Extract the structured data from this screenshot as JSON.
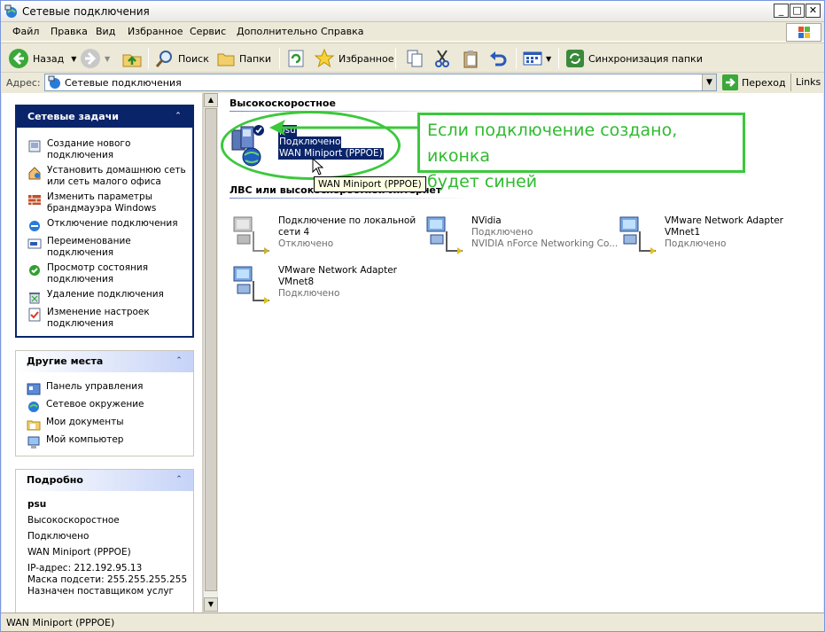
{
  "window": {
    "title": "Сетевые подключения"
  },
  "menu": [
    "Файл",
    "Правка",
    "Вид",
    "Избранное",
    "Сервис",
    "Дополнительно",
    "Справка"
  ],
  "toolbar": {
    "back": "Назад",
    "search": "Поиск",
    "folders": "Папки",
    "favorites": "Избранное",
    "sync": "Синхронизация папки"
  },
  "address": {
    "label": "Адрес:",
    "value": "Сетевые подключения",
    "go": "Переход",
    "links": "Links"
  },
  "left": {
    "tasks": {
      "title": "Сетевые задачи",
      "items": [
        [
          "Создание нового",
          "подключения"
        ],
        [
          "Установить домашнюю сеть",
          "или сеть малого офиса"
        ],
        [
          "Изменить параметры",
          "брандмауэра Windows"
        ],
        [
          "Отключение подключения"
        ],
        [
          "Переименование",
          "подключения"
        ],
        [
          "Просмотр состояния",
          "подключения"
        ],
        [
          "Удаление подключения"
        ],
        [
          "Изменение настроек",
          "подключения"
        ]
      ]
    },
    "places": {
      "title": "Другие места",
      "items": [
        "Панель управления",
        "Сетевое окружение",
        "Мои документы",
        "Мой компьютер"
      ]
    },
    "details": {
      "title": "Подробно",
      "name": "psu",
      "lines": [
        "Высокоскоростное",
        "Подключено",
        "WAN Miniport (PPPOE)",
        "IP-адрес: 212.192.95.13",
        "Маска подсети: 255.255.255.255",
        "Назначен поставщиком услуг"
      ]
    }
  },
  "content": {
    "section_highspeed": "Высокоскоростное",
    "section_lan": "ЛВС или высокоскоростной Интернет",
    "psu": {
      "name": "psu",
      "status": "Подключено",
      "device": "WAN Miniport (PPPOE)"
    },
    "tooltip": "WAN Miniport (PPPOE)",
    "lan_items": [
      {
        "name1": "Подключение по локальной",
        "name2": "сети 4",
        "status": "Отключено"
      },
      {
        "name1": "NVidia",
        "name2": "",
        "status": "Подключено",
        "device": "NVIDIA nForce Networking Co..."
      },
      {
        "name1": "VMware Network Adapter",
        "name2": "VMnet1",
        "status": "Подключено"
      },
      {
        "name1": "VMware Network Adapter",
        "name2": "VMnet8",
        "status": "Подключено"
      }
    ]
  },
  "annotation": {
    "line1": "Если подключение создано, иконка",
    "line2": "будет синей"
  },
  "status": "WAN Miniport (PPPOE)",
  "colors": {
    "selection": "#0a246a",
    "annotation": "#3cc83c"
  }
}
